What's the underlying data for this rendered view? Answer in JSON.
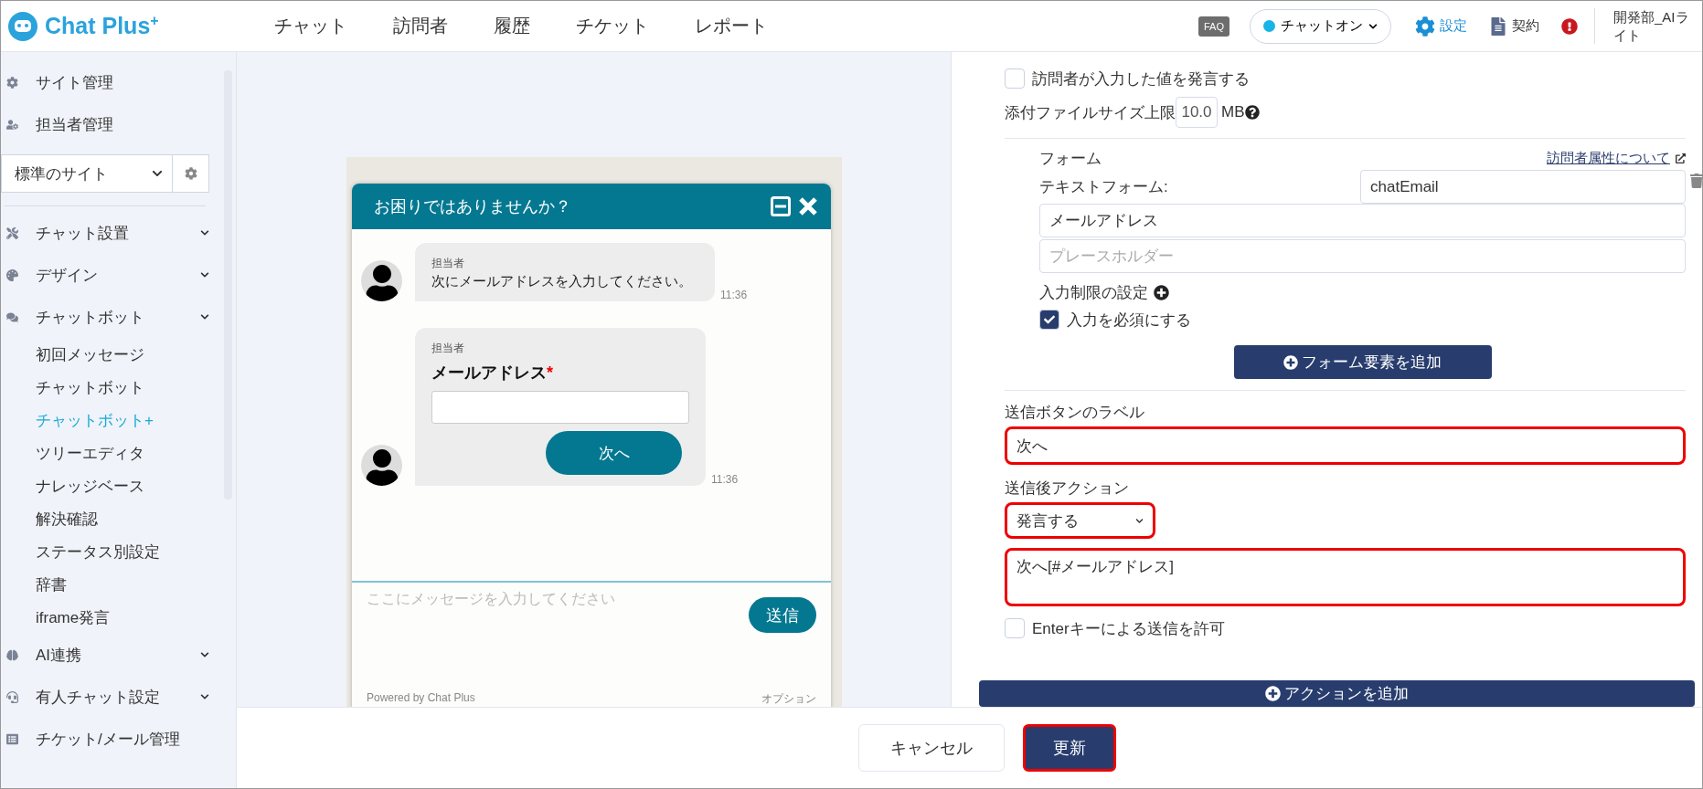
{
  "header": {
    "logo": "Chat Plus",
    "logo_sup": "+",
    "nav": [
      {
        "label": "チャット"
      },
      {
        "label": "訪問者"
      },
      {
        "label": "履歴"
      },
      {
        "label": "チケット"
      },
      {
        "label": "レポート"
      }
    ],
    "faq": "FAQ",
    "status": {
      "label": "チャットオン",
      "on": true
    },
    "settings": "設定",
    "contract": "契約",
    "user": "開発部_AIライト"
  },
  "sidebar": {
    "items": [
      {
        "kind": "link",
        "label": "サイト管理"
      },
      {
        "kind": "link",
        "label": "担当者管理"
      },
      {
        "kind": "select",
        "label": "標準のサイト"
      },
      {
        "kind": "group",
        "label": "チャット設置"
      },
      {
        "kind": "group",
        "label": "デザイン"
      },
      {
        "kind": "group",
        "label": "チャットボット",
        "children": [
          {
            "label": "初回メッセージ",
            "selected": false
          },
          {
            "label": "チャットボット",
            "selected": false
          },
          {
            "label": "チャットボット+",
            "selected": true
          },
          {
            "label": "ツリーエディタ",
            "selected": false
          },
          {
            "label": "ナレッジベース",
            "selected": false
          },
          {
            "label": "解決確認",
            "selected": false
          },
          {
            "label": "ステータス別設定",
            "selected": false
          },
          {
            "label": "辞書",
            "selected": false
          },
          {
            "label": "iframe発言",
            "selected": false
          }
        ]
      },
      {
        "kind": "group",
        "label": "AI連携"
      },
      {
        "kind": "group",
        "label": "有人チャット設定"
      },
      {
        "kind": "link",
        "label": "チケット/メール管理"
      }
    ]
  },
  "preview": {
    "title": "お困りではありませんか？",
    "messages": [
      {
        "kind": "text",
        "sender": "担当者",
        "text": "次にメールアドレスを入力してください。",
        "time": "11:36"
      },
      {
        "kind": "form",
        "sender": "担当者",
        "label": "メールアドレス",
        "required": true,
        "required_mark": "*",
        "button": "次へ",
        "time": "11:36"
      }
    ],
    "input_placeholder": "ここにメッセージを入力してください",
    "send": "送信",
    "powered": "Powered by Chat Plus",
    "option": "オプション"
  },
  "settings": {
    "echo": {
      "label": "訪問者が入力した値を発言する",
      "checked": false
    },
    "attachment": {
      "label": "添付ファイルサイズ上限",
      "value": "10.0",
      "unit": "MB"
    },
    "form": {
      "title": "フォーム",
      "link": "訪問者属性について",
      "type_label": "テキストフォーム:",
      "variable": "chatEmail",
      "label_value": "メールアドレス",
      "placeholder": "プレースホルダー",
      "restrict": "入力制限の設定",
      "required": {
        "label": "入力を必須にする",
        "checked": true
      },
      "add_button": "フォーム要素を追加"
    },
    "submit_label": {
      "title": "送信ボタンのラベル",
      "value": "次へ",
      "highlighted": true
    },
    "after_action": {
      "title": "送信後アクション",
      "value": "発言する",
      "highlighted": true
    },
    "message": {
      "value": "次へ[#メールアドレス]",
      "highlighted": true
    },
    "enter": {
      "label": "Enterキーによる送信を許可",
      "checked": false
    },
    "add_action": "アクションを追加"
  },
  "footer": {
    "buttons": [
      {
        "kind": "cancel",
        "label": "キャンセル",
        "highlighted": false
      },
      {
        "kind": "primary",
        "label": "更新",
        "highlighted": true
      }
    ]
  }
}
